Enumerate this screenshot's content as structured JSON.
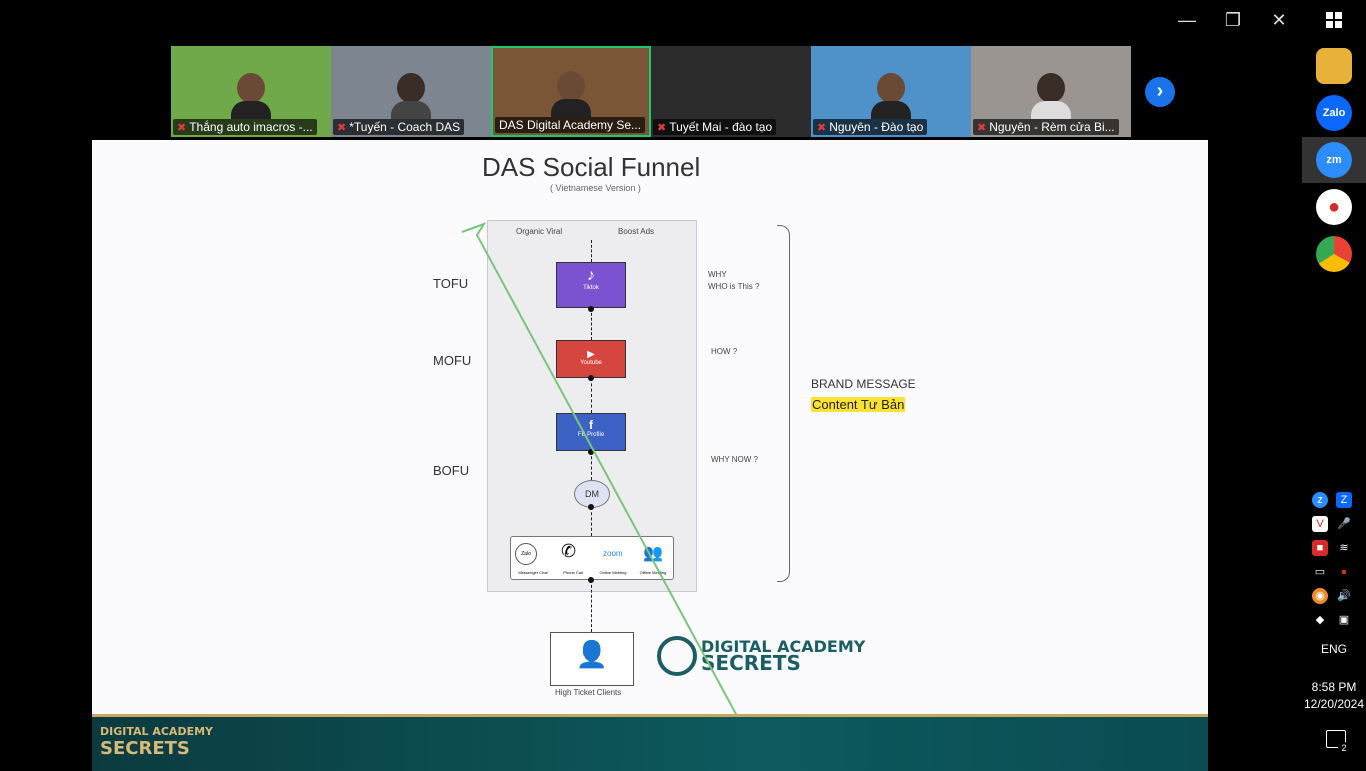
{
  "window": {
    "minimize": "—",
    "restore": "❐",
    "close": "✕"
  },
  "participants": [
    {
      "name": "Thắng auto imacros -...",
      "bg": "#6fa94a"
    },
    {
      "name": "*Tuyến - Coach DAS",
      "bg": "#7d8590"
    },
    {
      "name": "DAS Digital Academy Se...",
      "bg": "#7a5636",
      "active": true
    },
    {
      "name": "Tuyết Mai - đào tạo",
      "bg": "#2c2c2c"
    },
    {
      "name": "Nguyên - Đào tạo",
      "bg": "#4f91c9"
    },
    {
      "name": "Nguyên - Rèm cửa Bi...",
      "bg": "#9a9591"
    }
  ],
  "slide": {
    "title": "DAS Social Funnel",
    "subtitle": "( Vietnamese Version )",
    "sources": [
      "Organic Viral",
      "Boost Ads"
    ],
    "stages": [
      "TOFU",
      "MOFU",
      "BOFU"
    ],
    "channels": [
      "Tiktok",
      "Youtube",
      "FB Profile",
      "DM"
    ],
    "contacts": [
      "Messenger Chat",
      "Phone Call",
      "Online Meeting",
      "Offline Meeting"
    ],
    "zoom_word": "zoom",
    "zalo_word": "Zalo",
    "questions": [
      "WHY",
      "WHO is This ?",
      "HOW ?",
      "WHY NOW ?"
    ],
    "brand_message": "BRAND MESSAGE",
    "content": "Content Tư Bản",
    "client": "High Ticket Clients",
    "logo_line1": "DIGITAL ACADEMY",
    "logo_line2": "SECRETS",
    "footer_logo_line1": "DIGITAL ACADEMY",
    "footer_logo_line2": "SECRETS"
  },
  "taskbar": {
    "apps": [
      {
        "name": "file-explorer-icon",
        "label": "",
        "color": "#e8b23a"
      },
      {
        "name": "zalo-icon",
        "label": "Zalo",
        "color": "#0a68ff"
      },
      {
        "name": "zoom-icon",
        "label": "zm",
        "color": "#2d8cff"
      },
      {
        "name": "record-icon",
        "label": "●",
        "color": "#d62b2b"
      },
      {
        "name": "chrome-icon",
        "label": "",
        "color": "#e94235"
      }
    ],
    "lang": "ENG",
    "time": "8:58 PM",
    "date": "12/20/2024",
    "notifications": "2"
  }
}
